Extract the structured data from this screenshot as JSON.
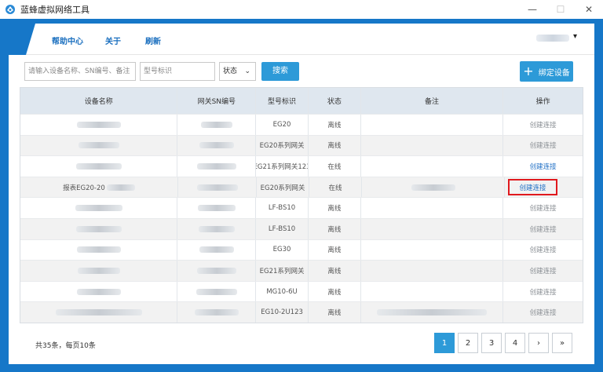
{
  "window": {
    "title": "蓝蜂虚拟网络工具",
    "minimize": "—",
    "maximize": "☐",
    "close": "✕"
  },
  "menu": {
    "help": "帮助中心",
    "about": "关于",
    "refresh": "刷新",
    "user_caret": "▾"
  },
  "filters": {
    "device_placeholder": "请输入设备名称、SN编号、备注",
    "model_placeholder": "型号标识",
    "status_label": "状态",
    "status_caret": "⌄",
    "search_label": "搜索",
    "bind_plus": "+",
    "bind_label": "绑定设备"
  },
  "table": {
    "headers": [
      "设备名称",
      "网关SN编号",
      "型号标识",
      "状态",
      "备注",
      "操作"
    ],
    "rows": [
      {
        "name": "",
        "sn": "",
        "model": "EG20",
        "status": "离线",
        "remark": "",
        "action": "创建连接",
        "active": false
      },
      {
        "name": "",
        "sn": "",
        "model": "EG20系列网关",
        "status": "离线",
        "remark": "",
        "action": "创建连接",
        "active": false
      },
      {
        "name": "",
        "sn": "",
        "model": "EG21系列网关123",
        "status": "在线",
        "remark": "",
        "action": "创建连接",
        "active": true
      },
      {
        "name": "报表EG20-20",
        "sn": "",
        "model": "EG20系列网关",
        "status": "在线",
        "remark": "",
        "action": "创建连接",
        "active": true
      },
      {
        "name": "",
        "sn": "",
        "model": "LF-BS10",
        "status": "离线",
        "remark": "",
        "action": "创建连接",
        "active": false
      },
      {
        "name": "",
        "sn": "",
        "model": "LF-BS10",
        "status": "离线",
        "remark": "",
        "action": "创建连接",
        "active": false
      },
      {
        "name": "",
        "sn": "",
        "model": "EG30",
        "status": "离线",
        "remark": "",
        "action": "创建连接",
        "active": false
      },
      {
        "name": "",
        "sn": "",
        "model": "EG21系列网关",
        "status": "离线",
        "remark": "",
        "action": "创建连接",
        "active": false
      },
      {
        "name": "",
        "sn": "",
        "model": "MG10-6U",
        "status": "离线",
        "remark": "",
        "action": "创建连接",
        "active": false
      },
      {
        "name": "",
        "sn": "",
        "model": "EG10-2U123",
        "status": "离线",
        "remark": "",
        "action": "创建连接",
        "active": false
      }
    ]
  },
  "footer": {
    "total_text": "共35条，每页10条",
    "pages": [
      "1",
      "2",
      "3",
      "4"
    ],
    "current_page": "1",
    "next": "›",
    "last": "»"
  },
  "colors": {
    "accent": "#2d9ad8",
    "frame": "#1677c8",
    "highlight": "#e0191e"
  }
}
